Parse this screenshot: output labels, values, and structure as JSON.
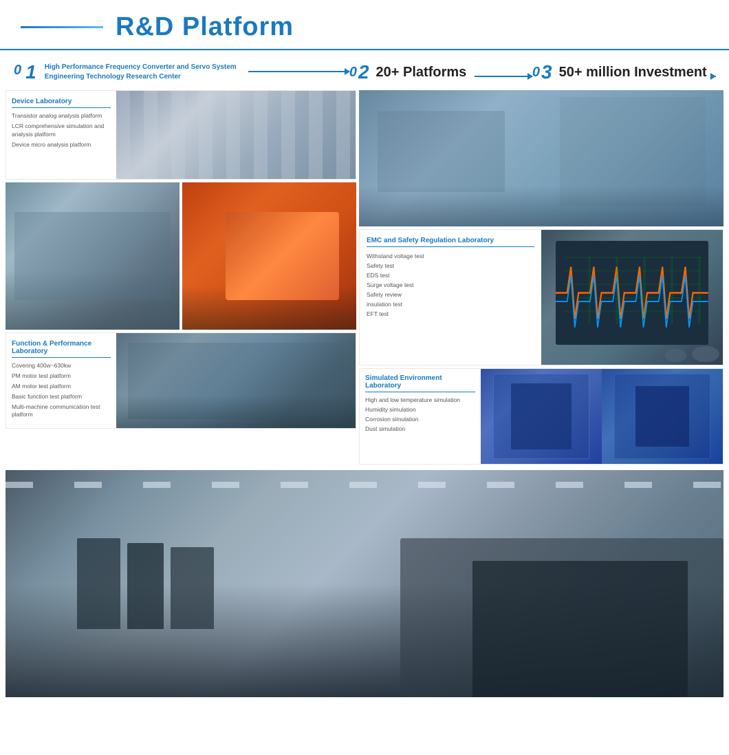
{
  "header": {
    "line_decoration": true,
    "title": "R&D Platform"
  },
  "section01": {
    "num": "01",
    "label": "High Performance Frequency Converter and Servo System Engineering Technology Research Center"
  },
  "section02": {
    "num": "02",
    "label": "20+ Platforms"
  },
  "section03": {
    "num": "03",
    "label": "50+ million Investment"
  },
  "device_lab": {
    "title": "Device Laboratory",
    "items": [
      "Transistor analog analysis platform",
      "LCR comprehensive simulation and analysis platform",
      "Device micro analysis platform"
    ]
  },
  "emc_lab": {
    "title": "EMC and Safety Regulation Laboratory",
    "items": [
      "Withstand voltage test",
      "Safety test",
      "EDS test",
      "Surge voltage test",
      "Safety review",
      "insulation test",
      "EFT test"
    ]
  },
  "function_lab": {
    "title": "Function & Performance Laboratory",
    "items": [
      "Covering 400w~630kw",
      "PM motor test platform",
      "AM motor test platform",
      "Basic function test platform",
      "Multi-machine communication test platform"
    ]
  },
  "simulated_lab": {
    "title": "Simulated Environment Laboratory",
    "items": [
      "High and low temperature simulation",
      "Humidity simulation",
      "Corrosion simulation",
      "Dust simulation"
    ]
  }
}
